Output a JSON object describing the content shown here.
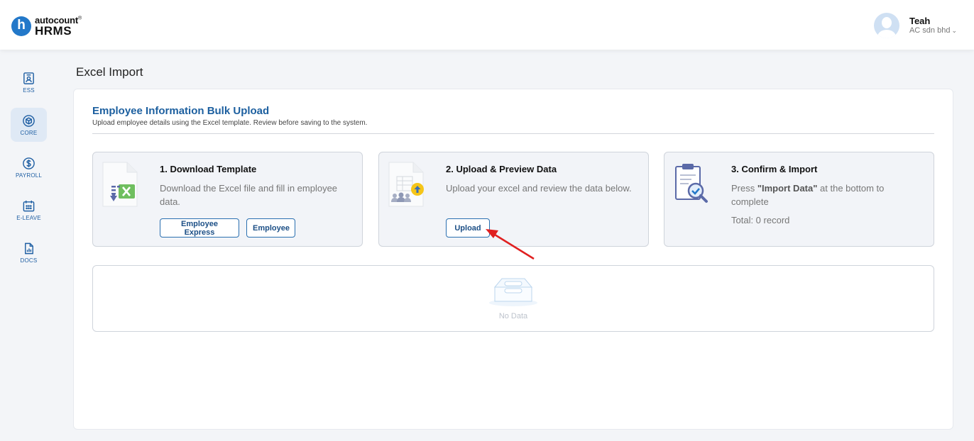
{
  "header": {
    "logo_letter": "h",
    "brand": "autocount",
    "product": "HRMS",
    "user_name": "Teah",
    "user_company": "AC sdn bhd"
  },
  "sidebar": {
    "items": [
      {
        "label": "ESS",
        "icon": "ess-badge-icon"
      },
      {
        "label": "CORE",
        "icon": "cube-icon",
        "active": true
      },
      {
        "label": "PAYROLL",
        "icon": "dollar-circle-icon"
      },
      {
        "label": "E-LEAVE",
        "icon": "calendar-icon"
      },
      {
        "label": "DOCS",
        "icon": "document-chart-icon"
      }
    ]
  },
  "page": {
    "title": "Excel Import",
    "section_title": "Employee Information Bulk Upload",
    "section_subtitle": "Upload employee details using the Excel template. Review before saving to the system."
  },
  "steps": [
    {
      "title": "1. Download Template",
      "description": "Download the Excel file and fill in employee data.",
      "buttons": [
        "Employee Express",
        "Employee"
      ],
      "icon": "excel-download-icon"
    },
    {
      "title": "2. Upload & Preview Data",
      "description": "Upload your excel and review the data below.",
      "buttons": [
        "Upload"
      ],
      "icon": "upload-preview-icon"
    },
    {
      "title": "3. Confirm & Import",
      "description_prefix": "Press ",
      "description_bold": "\"Import Data\"",
      "description_suffix": " at the bottom to complete",
      "total": "Total: 0 record",
      "icon": "clipboard-check-icon"
    }
  ],
  "empty_state": {
    "text": "No Data",
    "icon": "empty-box-icon"
  },
  "colors": {
    "brand_blue": "#2378c9",
    "section_title": "#1c5f9f",
    "card_bg": "#f2f4f8",
    "annotation_arrow": "#e02020"
  }
}
